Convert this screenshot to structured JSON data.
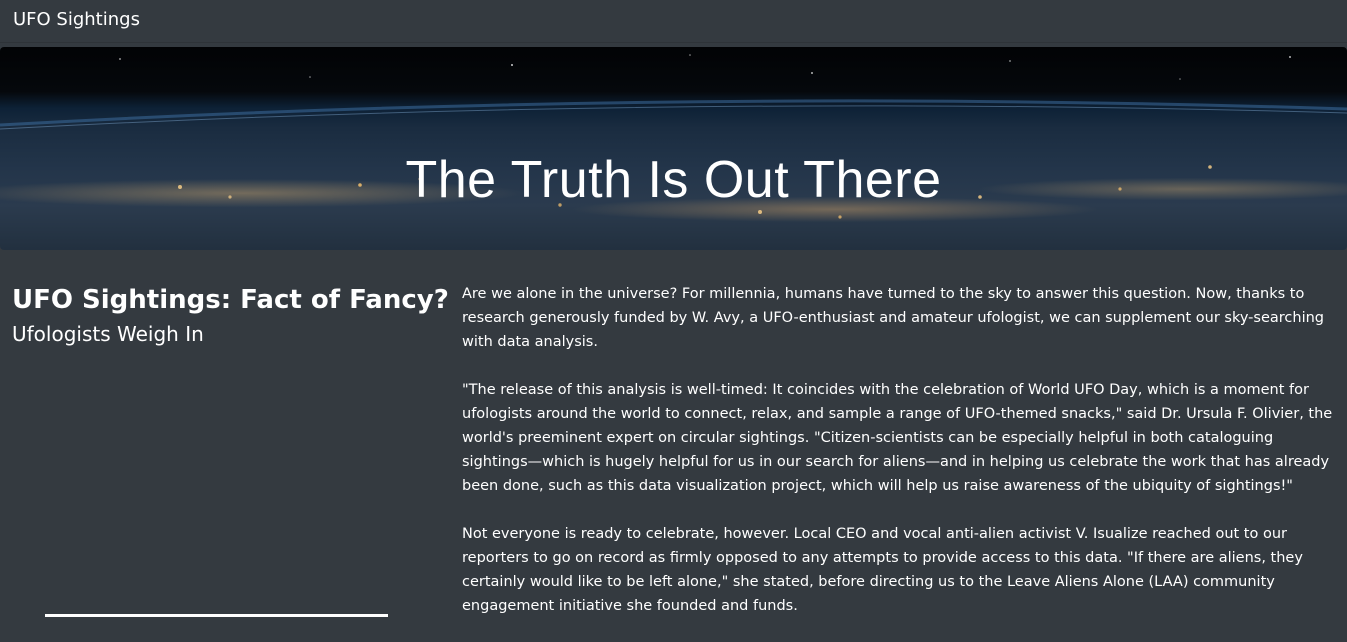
{
  "navbar": {
    "brand": "UFO Sightings"
  },
  "hero": {
    "title": "The Truth Is Out There"
  },
  "article": {
    "title": "UFO Sightings: Fact of Fancy?",
    "subtitle": "Ufologists Weigh In",
    "paragraphs": [
      "Are we alone in the universe? For millennia, humans have turned to the sky to answer this question. Now, thanks to research generously funded by W. Avy, a UFO-enthusiast and amateur ufologist, we can supplement our sky-searching with data analysis.",
      "\"The release of this analysis is well-timed: It coincides with the celebration of World UFO Day, which is a moment for ufologists around the world to connect, relax, and sample a range of UFO-themed snacks,\" said Dr. Ursula F. Olivier, the world's preeminent expert on circular sightings. \"Citizen-scientists can be especially helpful in both cataloguing sightings—which is hugely helpful for us in our search for aliens—and in helping us celebrate the work that has already been done, such as this data visualization project, which will help us raise awareness of the ubiquity of sightings!\"",
      "Not everyone is ready to celebrate, however. Local CEO and vocal anti-alien activist V. Isualize reached out to our reporters to go on record as firmly opposed to any attempts to provide access to this data. \"If there are aliens, they certainly would like to be left alone,\" she stated, before directing us to the Leave Aliens Alone (LAA) community engagement initiative she founded and funds."
    ]
  },
  "colors": {
    "page_background": "#343a40",
    "text": "#ffffff"
  }
}
